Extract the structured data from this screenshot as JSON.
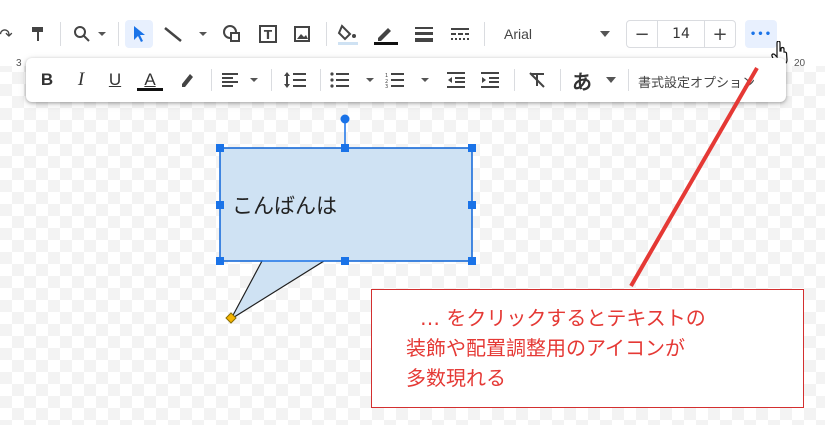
{
  "toolbar": {
    "font_name": "Arial",
    "font_size": "14",
    "size_minus": "−",
    "size_plus": "+",
    "more_label": "•••",
    "ruler_left": "3",
    "ruler_right": "20",
    "icons": [
      "undo-icon",
      "paint-format-icon",
      "zoom-icon",
      "select-icon",
      "line-icon",
      "shape-icon",
      "textbox-icon",
      "image-icon",
      "fill-color-icon",
      "border-color-icon",
      "border-weight-icon",
      "border-dash-icon"
    ],
    "accent_color": "#1a73e8"
  },
  "format_bar": {
    "bold": "B",
    "italic": "I",
    "underline": "U",
    "text_color": "A",
    "highlight": "✎",
    "align": "≡",
    "line_spacing": "↕",
    "bullets": "☰",
    "numbered": "☷",
    "indent_less": "⇤",
    "indent_more": "⇥",
    "clear_format": "⌧",
    "input_tools": "あ",
    "format_options_label": "書式設定オプション"
  },
  "callout": {
    "text": "こんばんは",
    "fill": "#cfe2f3",
    "border": "#1a73e8"
  },
  "annotation": {
    "line1": "…  をクリックするとテキストの",
    "line2": "装飾や配置調整用のアイコンが",
    "line3": "多数現れる",
    "color": "#e53935"
  }
}
